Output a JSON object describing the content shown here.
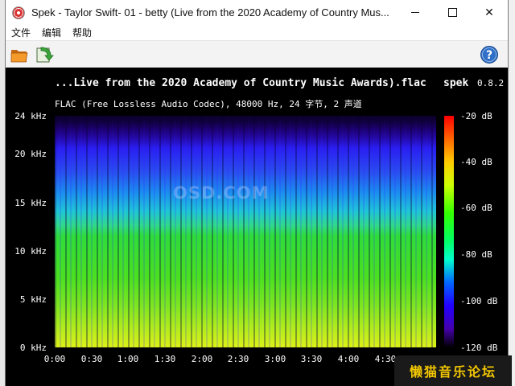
{
  "window": {
    "title": "Spek - Taylor Swift- 01 - betty (Live from the 2020 Academy of Country Mus..."
  },
  "menu": {
    "items": [
      "文件",
      "编辑",
      "帮助"
    ]
  },
  "toolbar": {
    "open_icon": "folder-open-icon",
    "save_icon": "save-export-icon",
    "help_icon": "help-icon",
    "help_glyph": "?"
  },
  "spectrum": {
    "filename": "...Live from the 2020 Academy of Country Music Awards).flac",
    "app_name": "spek",
    "app_version": "0.8.2",
    "info": "FLAC (Free Lossless Audio Codec), 48000 Hz, 24 字节, 2 声道",
    "watermark": "OSD.COM",
    "y_labels": [
      "24 kHz",
      "20 kHz",
      "15 kHz",
      "10 kHz",
      "5 kHz",
      "0 kHz"
    ],
    "x_labels": [
      "0:00",
      "0:30",
      "1:00",
      "1:30",
      "2:00",
      "2:30",
      "3:00",
      "3:30",
      "4:00",
      "4:30"
    ],
    "db_labels": [
      "-20 dB",
      "-40 dB",
      "-60 dB",
      "-80 dB",
      "-100 dB",
      "-120 dB"
    ]
  },
  "badge": {
    "text": "懒猫音乐论坛"
  },
  "colors": {
    "badge_text": "#f2c600",
    "background": "#000000"
  }
}
